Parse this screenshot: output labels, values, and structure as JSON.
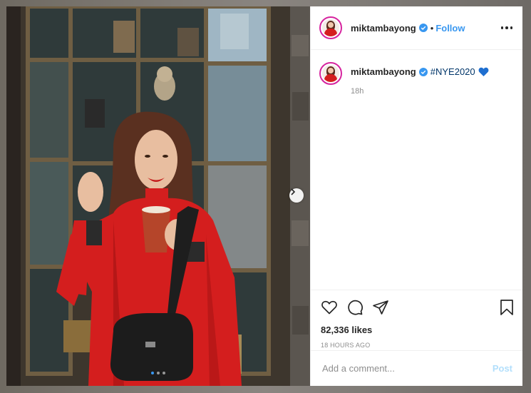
{
  "post": {
    "username": "miktambayong",
    "follow_label": "Follow",
    "separator": "•",
    "caption_hashtag": "#NYE2020",
    "caption_emoji": "blue-heart",
    "caption_time": "18h",
    "likes": "82,336 likes",
    "timestamp": "18 HOURS AGO",
    "comment_placeholder": "Add a comment...",
    "post_label": "Post"
  },
  "carousel": {
    "slides": 3,
    "active_index": 0
  },
  "colors": {
    "link_blue": "#3897f0",
    "verified_blue": "#3897f0",
    "coat_red": "#d41e1e"
  },
  "icons": [
    "verified-badge-icon",
    "more-options-icon",
    "heart-icon",
    "comment-icon",
    "share-icon",
    "bookmark-icon",
    "chevron-right-icon"
  ]
}
